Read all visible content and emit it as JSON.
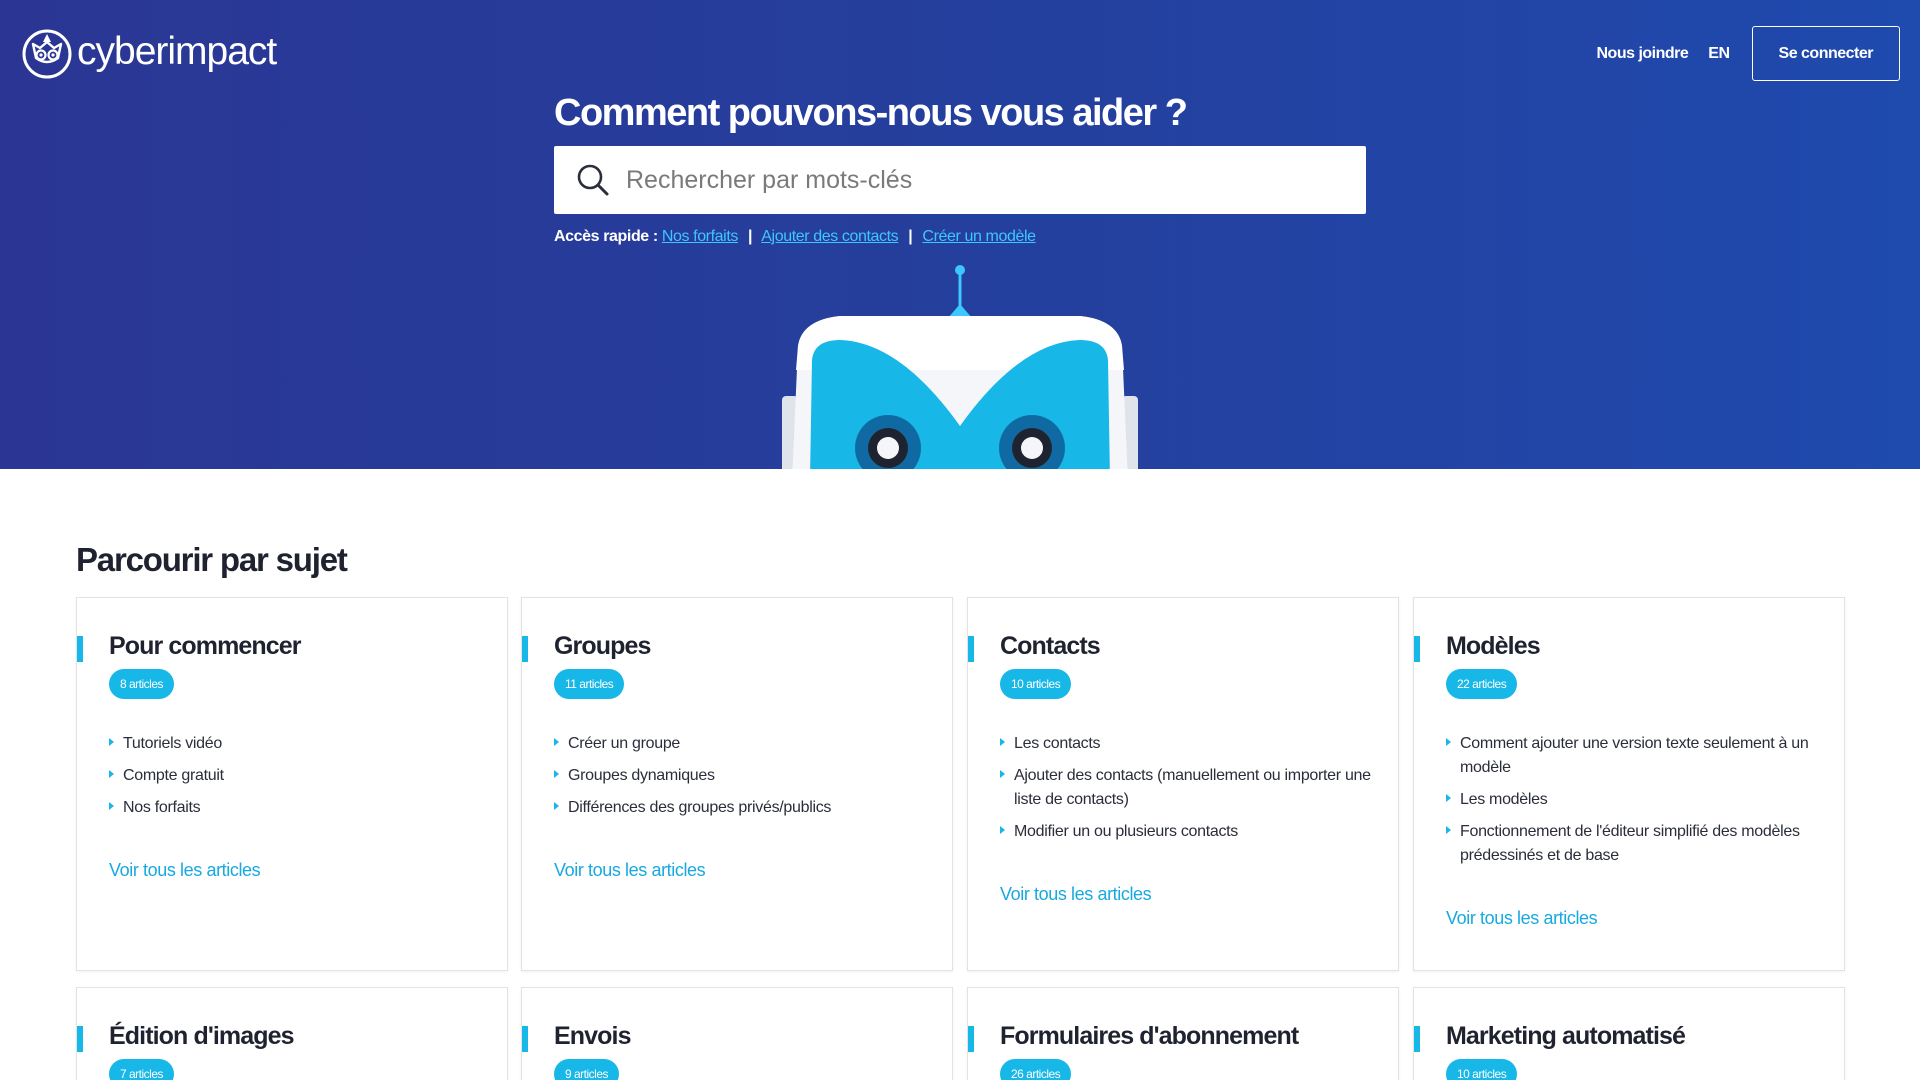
{
  "brand": {
    "name": "cyberimpact"
  },
  "topnav": {
    "contact": "Nous joindre",
    "lang": "EN",
    "login": "Se connecter"
  },
  "hero": {
    "title": "Comment pouvons-nous vous aider ?",
    "search_placeholder": "Rechercher par mots-clés",
    "quick_label": "Accès rapide :",
    "quick_links": [
      "Nos forfaits",
      "Ajouter des contacts",
      "Créer un modèle"
    ],
    "separator": "|"
  },
  "section": {
    "title": "Parcourir par sujet"
  },
  "cards": [
    {
      "title": "Pour commencer",
      "badge": "8 articles",
      "items": [
        "Tutoriels vidéo",
        "Compte gratuit",
        "Nos forfaits"
      ],
      "link": "Voir tous les articles"
    },
    {
      "title": "Groupes",
      "badge": "11 articles",
      "items": [
        "Créer un groupe",
        "Groupes dynamiques",
        "Différences des groupes privés/publics"
      ],
      "link": "Voir tous les articles"
    },
    {
      "title": "Contacts",
      "badge": "10 articles",
      "items": [
        "Les contacts",
        "Ajouter des contacts (manuellement ou importer une liste de contacts)",
        "Modifier un ou plusieurs contacts"
      ],
      "link": "Voir tous les articles"
    },
    {
      "title": "Modèles",
      "badge": "22 articles",
      "items": [
        "Comment ajouter une version texte seulement à un modèle",
        "Les modèles",
        "Fonctionnement de l'éditeur simplifié des modèles prédessinés et de base"
      ],
      "link": "Voir tous les articles"
    },
    {
      "title": "Édition d'images",
      "badge": "7 articles"
    },
    {
      "title": "Envois",
      "badge": "9 articles"
    },
    {
      "title": "Formulaires d'abonnement",
      "badge": "26 articles"
    },
    {
      "title": "Marketing automatisé",
      "badge": "10 articles"
    }
  ],
  "colors": {
    "hero_start": "#2b3694",
    "hero_end": "#1f4aae",
    "accent": "#17b7e8",
    "link": "#3ec6ff"
  },
  "icons": {
    "logo": "owl-logo-icon",
    "search": "search-icon",
    "mascot": "robot-mascot-icon",
    "bullet": "triangle-bullet-icon"
  }
}
